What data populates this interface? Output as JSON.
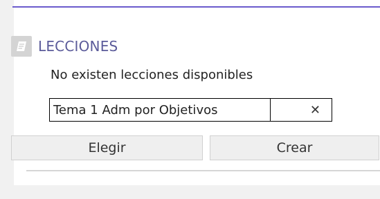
{
  "section": {
    "title": "LECCIONES",
    "icon": "book-icon"
  },
  "empty_message": "No existen lecciones disponibles",
  "lesson_input": {
    "value": "Tema 1 Adm por Objetivos",
    "clear_symbol": "✕"
  },
  "buttons": {
    "choose_label": "Elegir",
    "create_label": "Crear"
  },
  "colors": {
    "accent_rule": "#6a5acd",
    "title": "#5b5b9a"
  }
}
